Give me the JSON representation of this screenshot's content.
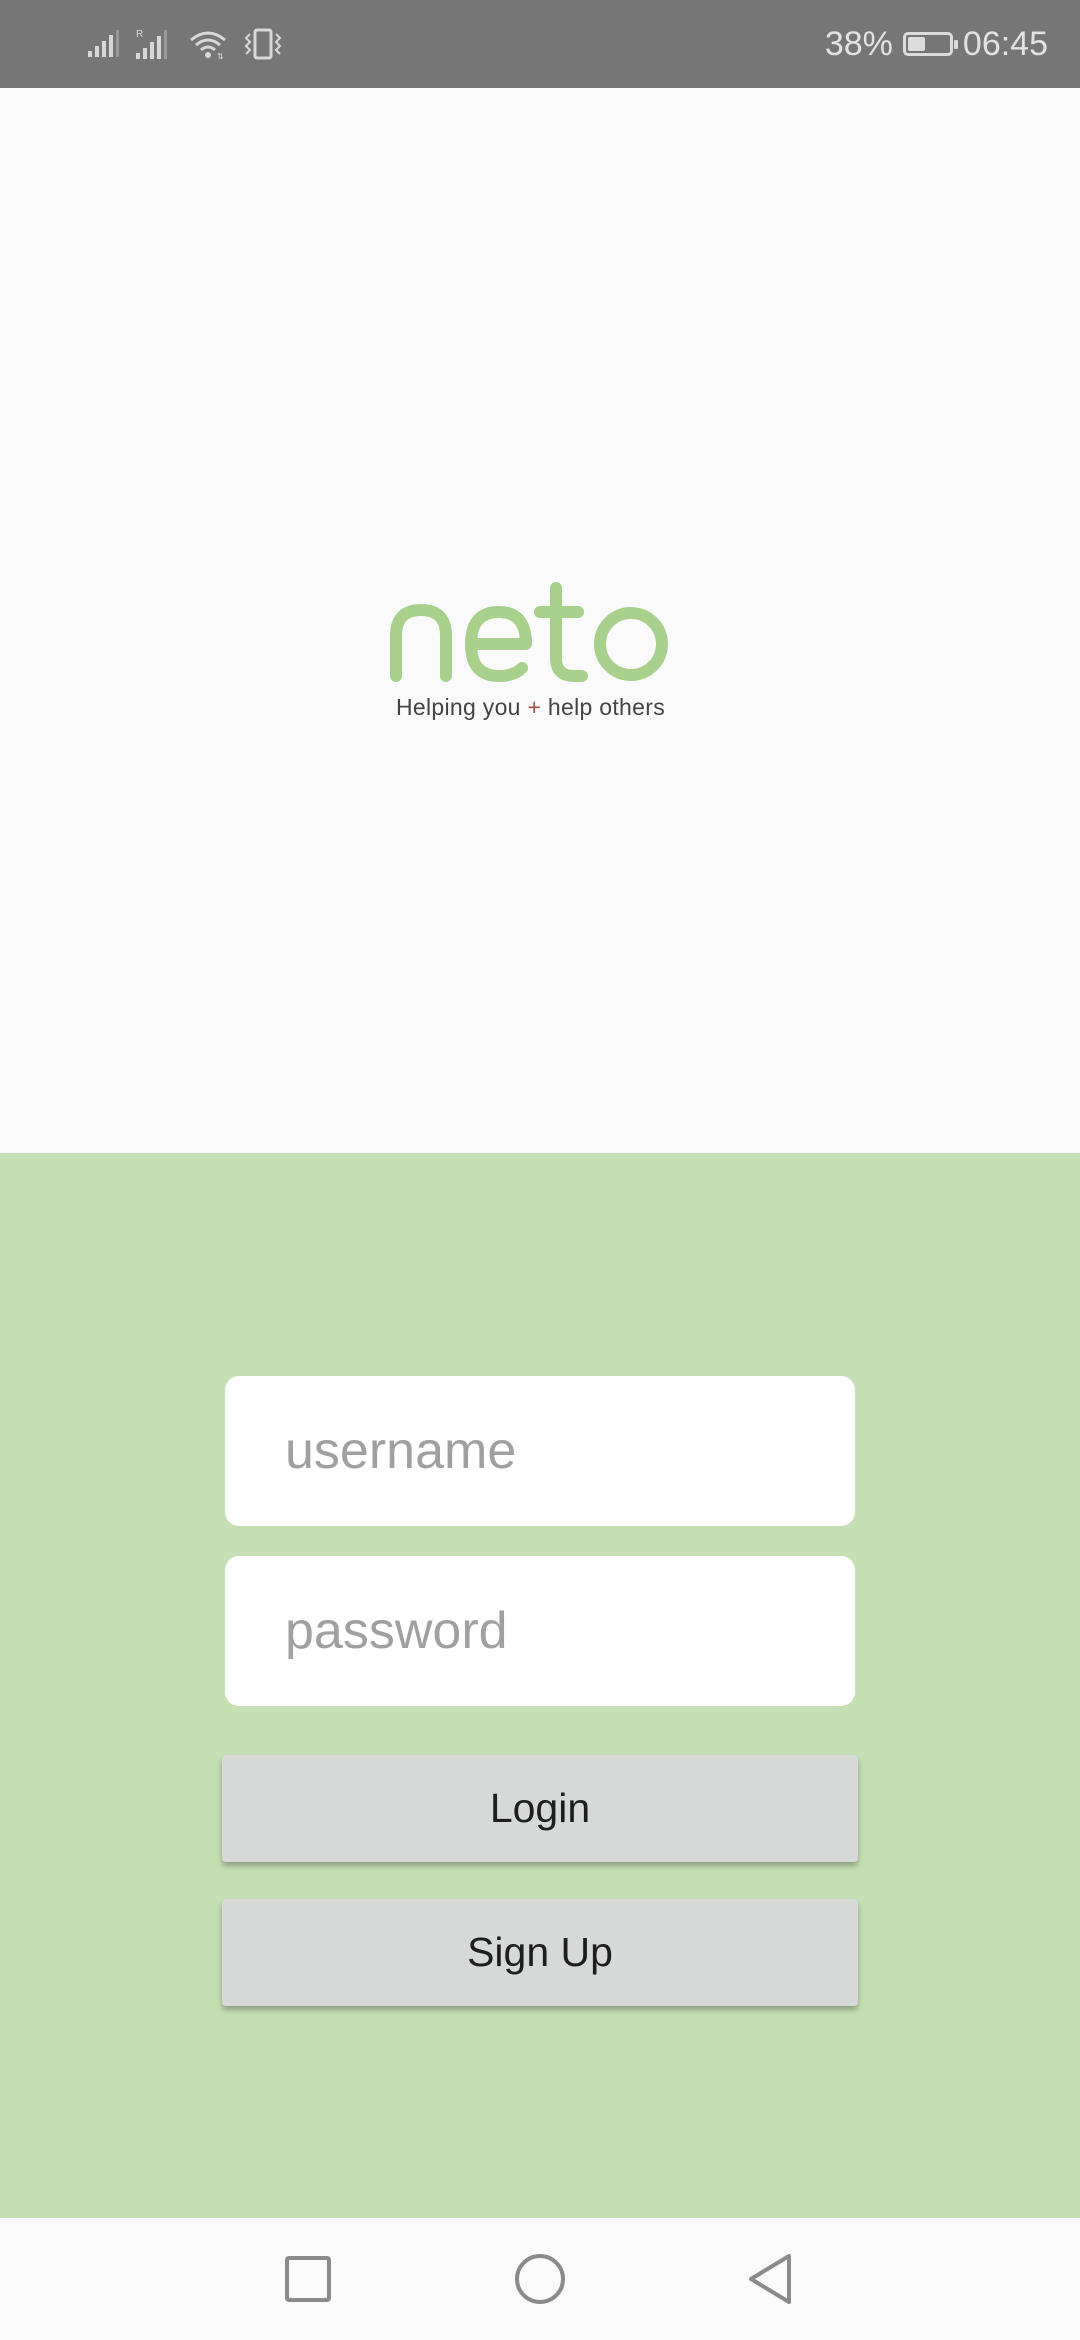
{
  "status_bar": {
    "battery_percent": "38%",
    "battery_level": 0.38,
    "time": "06:45",
    "icons": [
      "signal-icon",
      "signal-roaming-icon",
      "wifi-icon",
      "vibrate-icon",
      "battery-icon"
    ]
  },
  "logo": {
    "wordmark": "neto",
    "tagline_part1": "Helping you ",
    "tagline_plus": "+",
    "tagline_part2": " help others",
    "brand_color": "#a8d08d",
    "plus_color": "#a0524d"
  },
  "form": {
    "background_color": "#c5e0b4",
    "username_placeholder": "username",
    "username_value": "",
    "password_placeholder": "password",
    "password_value": "",
    "login_label": "Login",
    "signup_label": "Sign Up"
  },
  "nav_bar": {
    "icons": [
      "recents-icon",
      "home-icon",
      "back-icon"
    ]
  }
}
